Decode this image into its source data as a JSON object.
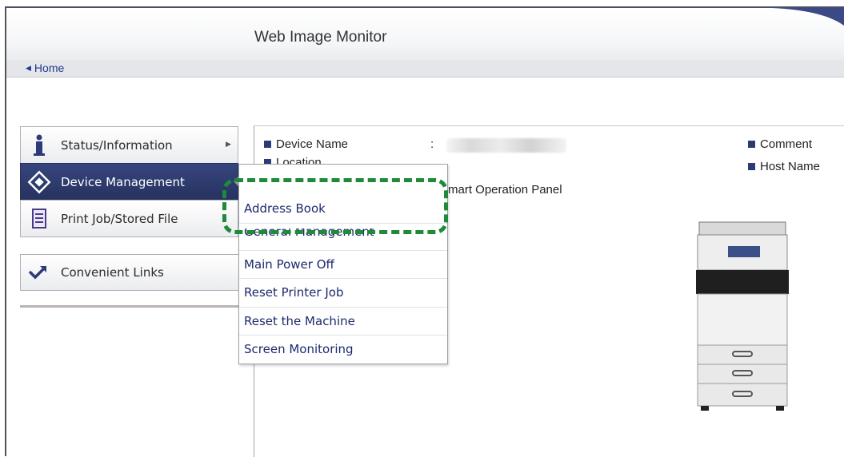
{
  "header": {
    "title": "Web Image Monitor"
  },
  "breadcrumb": {
    "home_label": "Home"
  },
  "side_menu": {
    "items": [
      {
        "label": "Status/Information",
        "icon": "info-icon",
        "active": false
      },
      {
        "label": "Device Management",
        "icon": "diamond-gear-icon",
        "active": true
      },
      {
        "label": "Print Job/Stored File",
        "icon": "document-icon",
        "active": false
      }
    ],
    "links": {
      "label": "Convenient Links",
      "icon": "arrow-link-icon"
    }
  },
  "device_info": {
    "device_name_label": "Device Name",
    "device_name_separator": ":",
    "location_label": "Location",
    "comment_label": "Comment",
    "host_name_label": "Host Name",
    "operation_panel_text": "mart Operation Panel"
  },
  "device_management_menu": {
    "items": [
      "Address Book",
      "General Management",
      "Main Power Off",
      "Reset Printer Job",
      "Reset the Machine",
      "Screen Monitoring"
    ]
  },
  "colors": {
    "active_menu": "#2d3a70",
    "highlight_dash": "#1e8a3a",
    "link_text": "#1c2a6b"
  }
}
